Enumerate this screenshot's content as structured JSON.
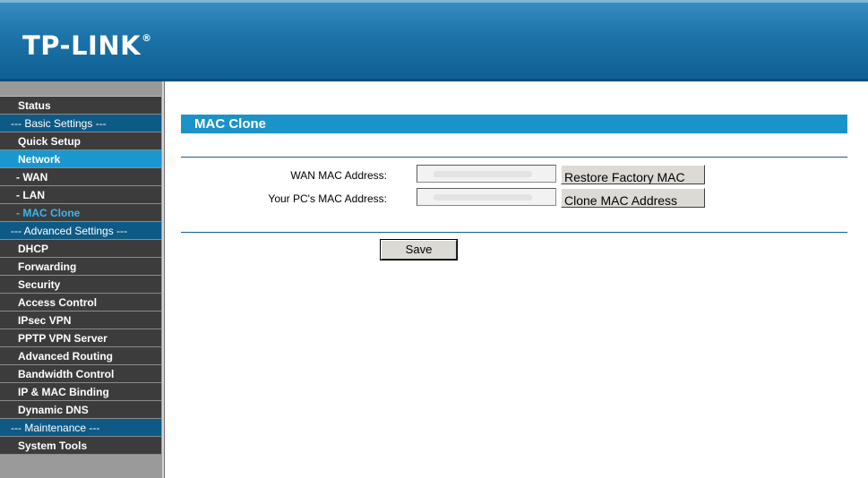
{
  "brand": {
    "logo_text": "TP-LINK",
    "logo_mark": "®"
  },
  "sidebar": {
    "items": [
      {
        "label": "Status",
        "type": "item"
      },
      {
        "label": "--- Basic Settings ---",
        "type": "section"
      },
      {
        "label": "Quick Setup",
        "type": "item"
      },
      {
        "label": "Network",
        "type": "item",
        "active": true
      },
      {
        "label": "- WAN",
        "type": "sub"
      },
      {
        "label": "- LAN",
        "type": "sub"
      },
      {
        "label": "- MAC Clone",
        "type": "sub",
        "current": true
      },
      {
        "label": "--- Advanced Settings ---",
        "type": "section"
      },
      {
        "label": "DHCP",
        "type": "item"
      },
      {
        "label": "Forwarding",
        "type": "item"
      },
      {
        "label": "Security",
        "type": "item"
      },
      {
        "label": "Access Control",
        "type": "item"
      },
      {
        "label": "IPsec VPN",
        "type": "item"
      },
      {
        "label": "PPTP VPN Server",
        "type": "item"
      },
      {
        "label": "Advanced Routing",
        "type": "item"
      },
      {
        "label": "Bandwidth Control",
        "type": "item"
      },
      {
        "label": "IP & MAC Binding",
        "type": "item"
      },
      {
        "label": "Dynamic DNS",
        "type": "item"
      },
      {
        "label": "--- Maintenance ---",
        "type": "section"
      },
      {
        "label": "System Tools",
        "type": "item"
      }
    ]
  },
  "main": {
    "title": "MAC Clone",
    "wan_mac_label": "WAN MAC Address:",
    "wan_mac_value": "",
    "restore_button": "Restore Factory MAC",
    "pc_mac_label": "Your PC's MAC Address:",
    "pc_mac_value": "",
    "clone_button": "Clone MAC Address",
    "save_button": "Save"
  },
  "colors": {
    "header_blue": "#1e76ab",
    "title_bar": "#1a93c9",
    "section_blue": "#0e5a86",
    "active_item": "#1b97cf",
    "menu_dark": "#3c3c3c"
  }
}
